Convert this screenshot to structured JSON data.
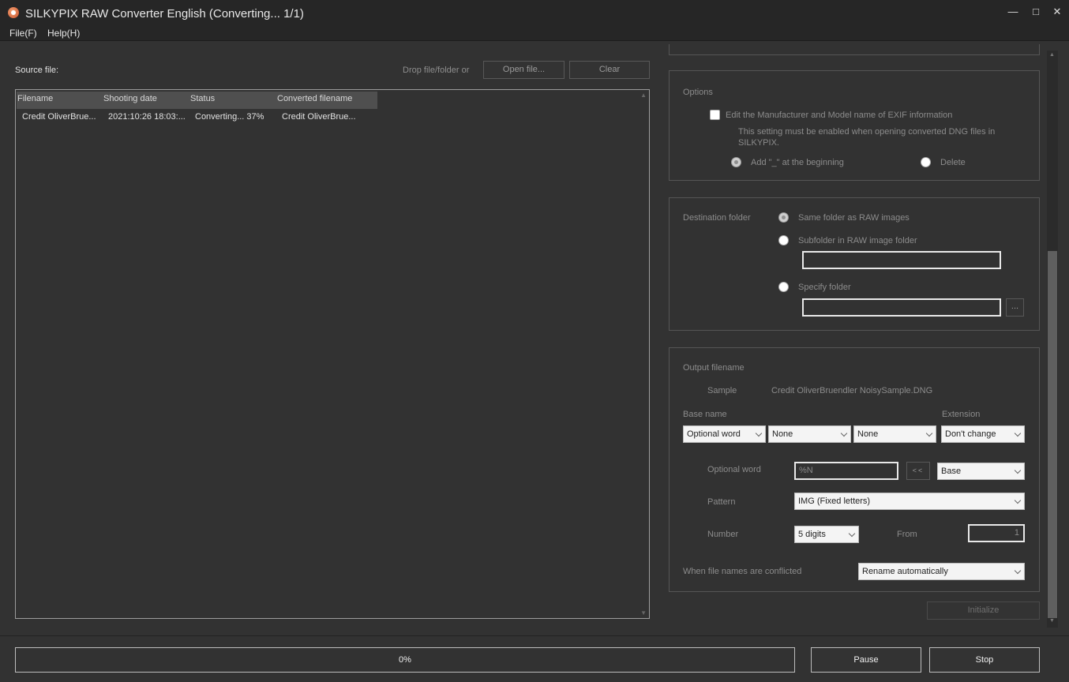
{
  "window": {
    "title": "SILKYPIX RAW Converter English (Converting... 1/1)"
  },
  "menu": [
    "File(F)",
    "Help(H)"
  ],
  "source": {
    "label": "Source file:",
    "drop_hint": "Drop file/folder or",
    "open_button": "Open file...",
    "clear_button": "Clear"
  },
  "file_list": {
    "columns": [
      "Filename",
      "Shooting date",
      "Status",
      "Converted filename"
    ],
    "rows": [
      [
        "Credit OliverBrue...",
        "2021:10:26 18:03:...",
        "Converting... 37%",
        "Credit OliverBrue..."
      ]
    ]
  },
  "options": {
    "title": "Options",
    "exif_checkbox": "Edit the Manufacturer and Model name of EXIF information",
    "exif_note": "This setting must be enabled when opening converted DNG files in SILKYPIX.",
    "add_radio": "Add \"_\" at the beginning",
    "delete_radio": "Delete"
  },
  "destination": {
    "label": "Destination folder",
    "same_folder": "Same folder as RAW images",
    "subfolder": "Subfolder in RAW image folder",
    "subfolder_value": "",
    "specify": "Specify folder",
    "specify_value": "",
    "browse": "..."
  },
  "output": {
    "title": "Output filename",
    "sample_label": "Sample",
    "sample_value": "Credit OliverBruendler NoisySample.DNG",
    "base_name_label": "Base name",
    "extension_label": "Extension",
    "base1": "Optional word",
    "base2": "None",
    "base3": "None",
    "extension": "Don't change",
    "optional_word_label": "Optional word",
    "optional_word_value": "%N",
    "insert_button": "<<",
    "optional_word_dd": "Base",
    "pattern_label": "Pattern",
    "pattern_value": "IMG (Fixed letters)",
    "number_label": "Number",
    "number_value": "5 digits",
    "from_label": "From",
    "from_value": "1",
    "conflict_label": "When file names are conflicted",
    "conflict_value": "Rename automatically",
    "initialize_button": "Initialize"
  },
  "progress": {
    "text": "0%",
    "percent": 0
  },
  "buttons": {
    "pause": "Pause",
    "stop": "Stop"
  },
  "colors": {
    "background": "#323232",
    "titlebar": "#262626",
    "progress_fill": "#4a7bd0"
  }
}
